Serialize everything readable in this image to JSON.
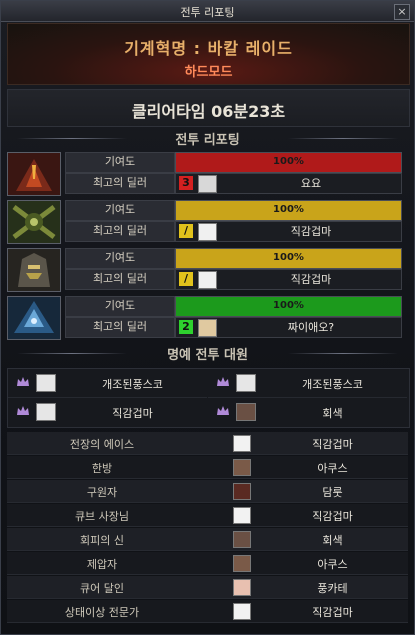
{
  "window": {
    "title": "전투 리포팅",
    "close_label": "×"
  },
  "header": {
    "raid_name": "기계혁명 : 바칼 레이드",
    "mode": "하드모드"
  },
  "clear": {
    "label": "클리어타임  06분23초"
  },
  "report_section": {
    "title": "전투 리포팅"
  },
  "players": [
    {
      "contribution_label": "기여도",
      "dealer_label": "최고의 딜러",
      "percent_text": "100%",
      "percent": 100,
      "bar_color": "#b01a1a",
      "rank": "3",
      "rank_color": "#d42020",
      "dealer": "요요",
      "mini_color": "#d8d8d8"
    },
    {
      "contribution_label": "기여도",
      "dealer_label": "최고의 딜러",
      "percent_text": "100%",
      "percent": 100,
      "bar_color": "#c9a41a",
      "rank": "/",
      "rank_color": "#e1c21c",
      "dealer": "직감겁마",
      "mini_color": "#f0f0f0"
    },
    {
      "contribution_label": "기여도",
      "dealer_label": "최고의 딜러",
      "percent_text": "100%",
      "percent": 100,
      "bar_color": "#c9a41a",
      "rank": "/",
      "rank_color": "#e1c21c",
      "dealer": "직감겁마",
      "mini_color": "#f0f0f0"
    },
    {
      "contribution_label": "기여도",
      "dealer_label": "최고의 딜러",
      "percent_text": "100%",
      "percent": 100,
      "bar_color": "#1c9a1c",
      "rank": "2",
      "rank_color": "#2ed12e",
      "dealer": "짜이애오?",
      "mini_color": "#e0c9a0"
    }
  ],
  "honor_section": {
    "title": "명예 전투 대원"
  },
  "honor": [
    {
      "name": "개조된풍스코"
    },
    {
      "name": "개조된풍스코"
    },
    {
      "name": "직감겁마"
    },
    {
      "name": "회색"
    }
  ],
  "awards": [
    {
      "title": "전장의 에이스",
      "name": "직감겁마",
      "mini_color": "#f2f2f2"
    },
    {
      "title": "한방",
      "name": "아쿠스",
      "mini_color": "#7a5a48"
    },
    {
      "title": "구원자",
      "name": "담룻",
      "mini_color": "#5a2a22"
    },
    {
      "title": "큐브 사장님",
      "name": "직감겁마",
      "mini_color": "#f2f2f2"
    },
    {
      "title": "회피의 신",
      "name": "회색",
      "mini_color": "#6a5044"
    },
    {
      "title": "제압자",
      "name": "아쿠스",
      "mini_color": "#7a5a48"
    },
    {
      "title": "큐어 달인",
      "name": "풍카테",
      "mini_color": "#e8c0b0"
    },
    {
      "title": "상태이상 전문가",
      "name": "직감겁마",
      "mini_color": "#f2f2f2"
    }
  ]
}
